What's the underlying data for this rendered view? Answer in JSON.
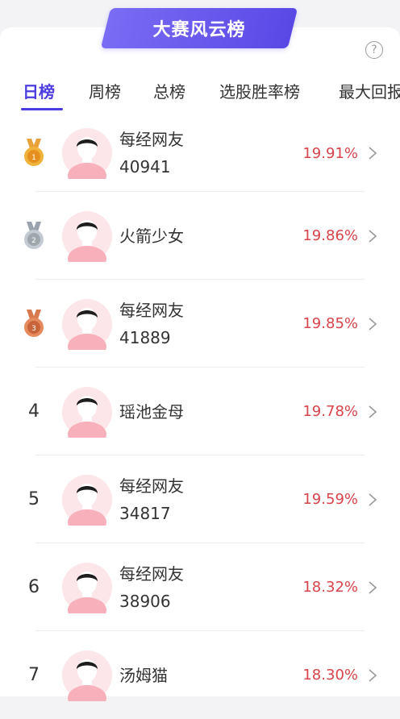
{
  "banner": {
    "title": "大赛风云榜"
  },
  "help": {
    "glyph": "?"
  },
  "tabs": [
    {
      "label": "日榜",
      "active": true
    },
    {
      "label": "周榜",
      "active": false
    },
    {
      "label": "总榜",
      "active": false
    },
    {
      "label": "选股胜率榜",
      "active": false
    },
    {
      "label": "最大回报",
      "active": false
    }
  ],
  "colors": {
    "accent": "#4b3de0",
    "percent": "#d9434a",
    "banner_start": "#7a6cf4",
    "banner_end": "#5a48e6"
  },
  "rows": [
    {
      "rank": "1",
      "medal": "gold",
      "name": "每经网友",
      "sub": "40941",
      "percent": "19.91%"
    },
    {
      "rank": "2",
      "medal": "silver",
      "name": "火箭少女",
      "sub": "",
      "percent": "19.86%"
    },
    {
      "rank": "3",
      "medal": "bronze",
      "name": "每经网友",
      "sub": "41889",
      "percent": "19.85%"
    },
    {
      "rank": "4",
      "medal": "",
      "name": "瑶池金母",
      "sub": "",
      "percent": "19.78%"
    },
    {
      "rank": "5",
      "medal": "",
      "name": "每经网友",
      "sub": "34817",
      "percent": "19.59%"
    },
    {
      "rank": "6",
      "medal": "",
      "name": "每经网友",
      "sub": "38906",
      "percent": "18.32%"
    },
    {
      "rank": "7",
      "medal": "",
      "name": "汤姆猫",
      "sub": "",
      "percent": "18.30%"
    }
  ]
}
